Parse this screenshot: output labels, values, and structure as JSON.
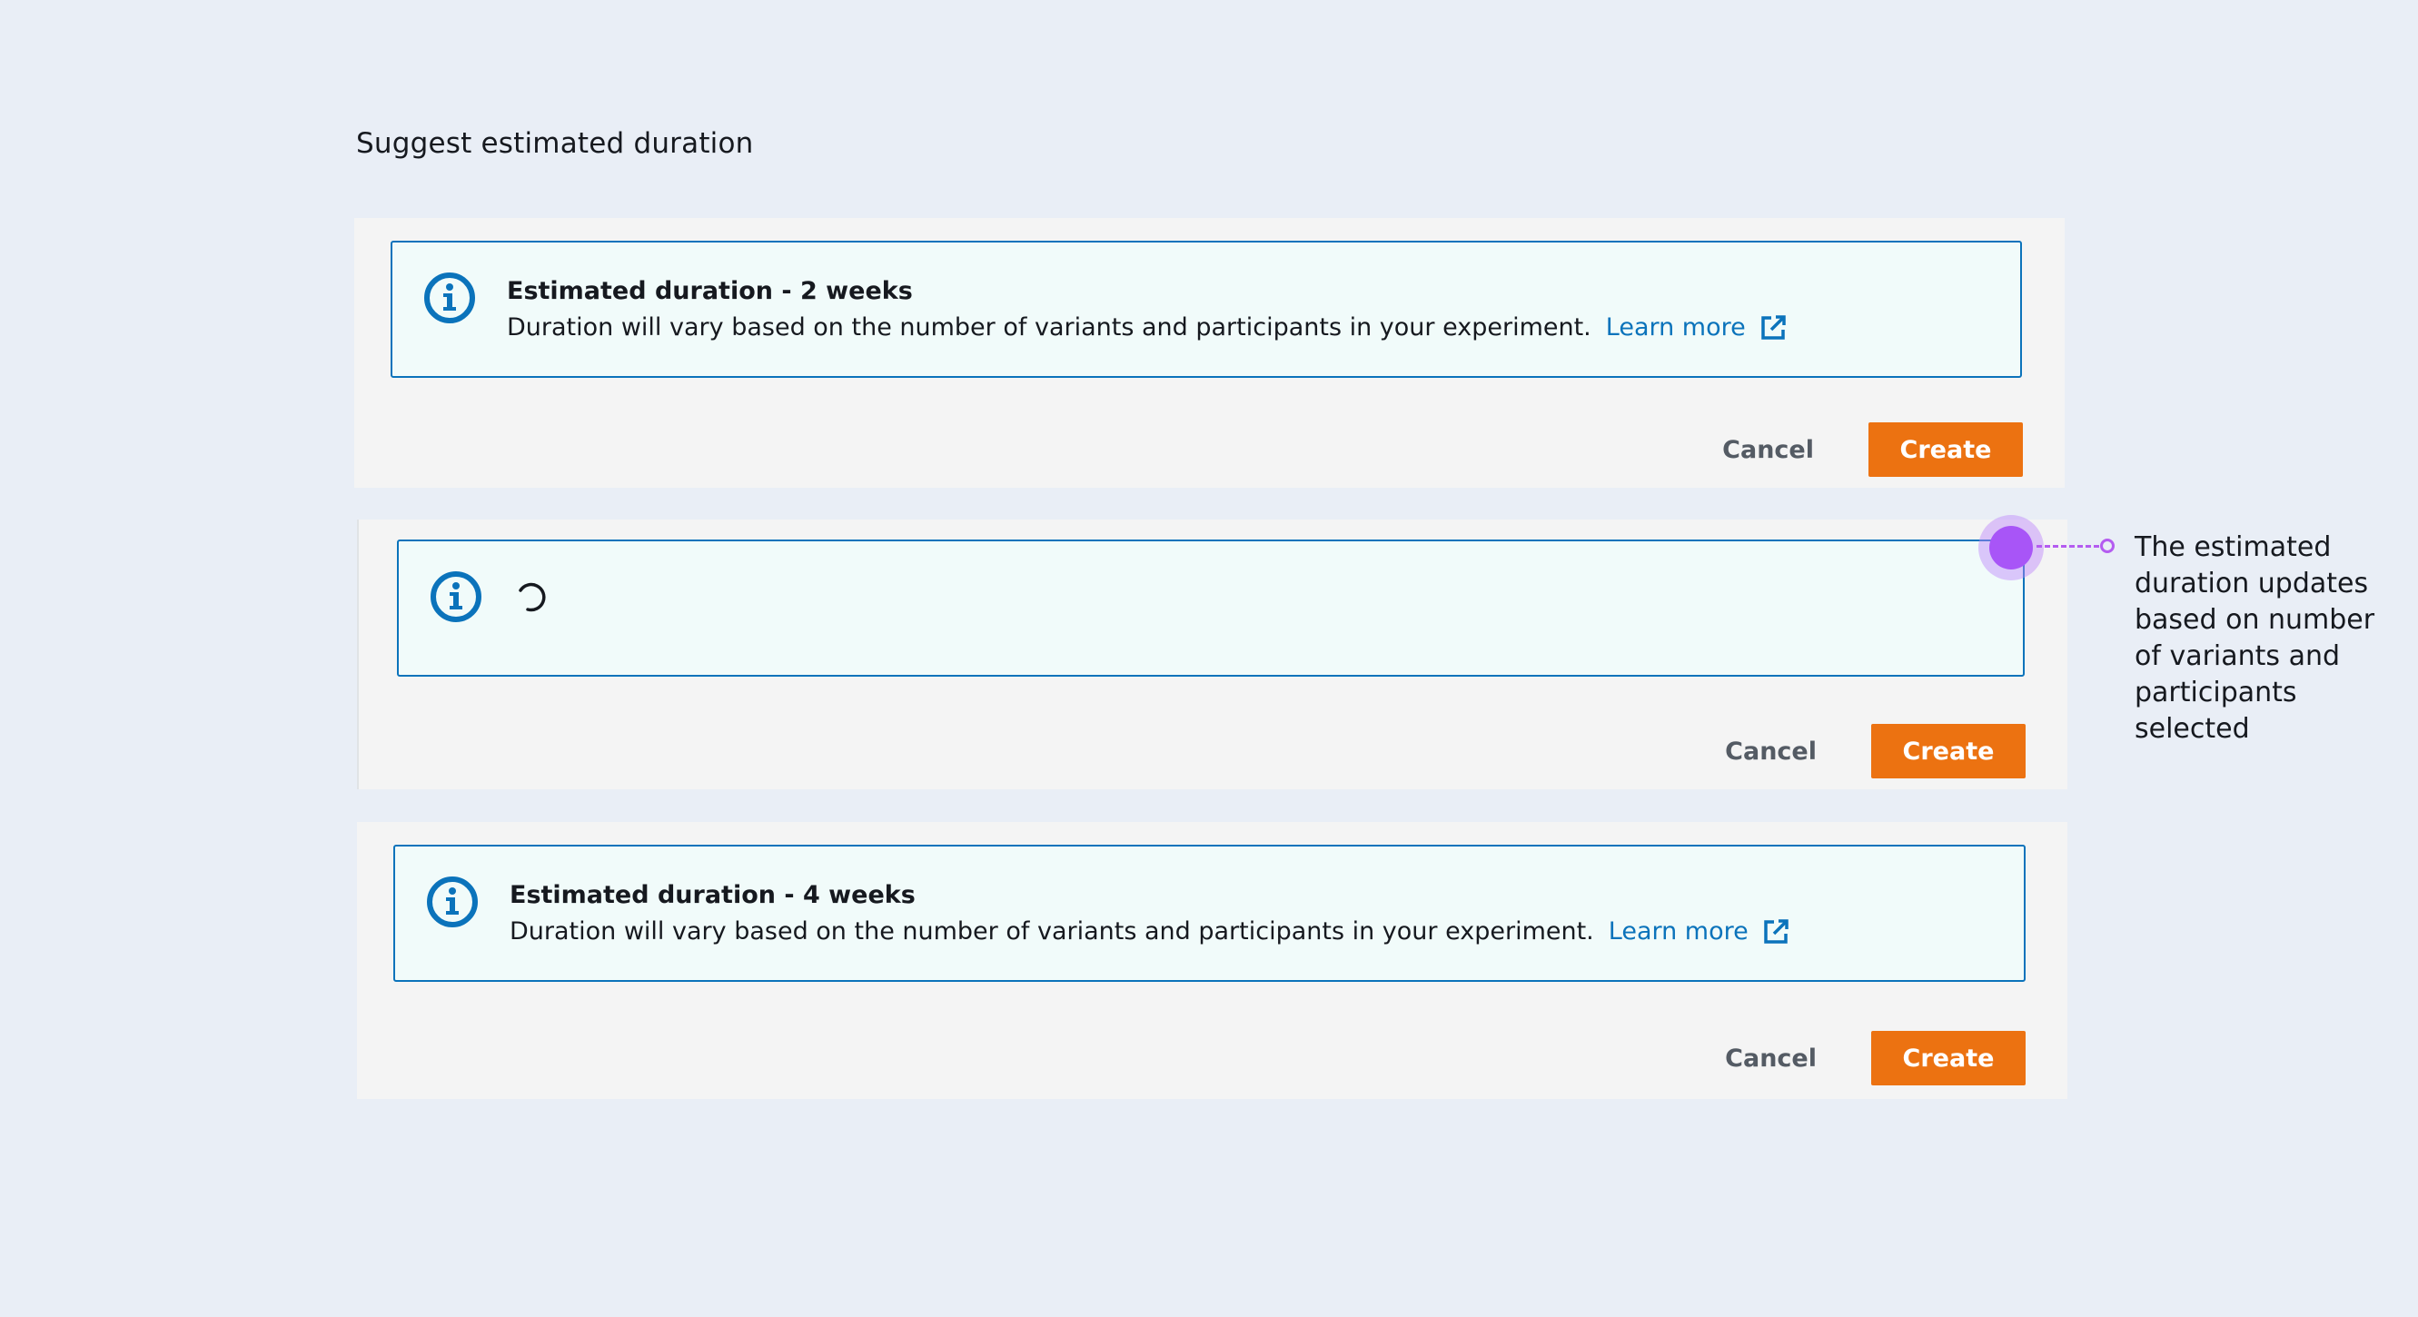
{
  "page": {
    "title": "Suggest estimated duration"
  },
  "colors": {
    "background": "#e9eef6",
    "card": "#f4f4f4",
    "alert_bg": "#f1fbfa",
    "info_blue": "#0b73bb",
    "primary": "#ec7211",
    "annotation": "#a855f7"
  },
  "cards": [
    {
      "state": "loaded",
      "alert": {
        "icon": "info-icon",
        "title": "Estimated duration - 2 weeks",
        "description": "Duration will vary based on the number of variants and participants in your experiment.",
        "link_label": "Learn more",
        "link_icon": "external-link-icon"
      },
      "cancel_label": "Cancel",
      "create_label": "Create"
    },
    {
      "state": "loading",
      "alert": {
        "icon": "info-icon",
        "loading_icon": "spinner-icon"
      },
      "cancel_label": "Cancel",
      "create_label": "Create"
    },
    {
      "state": "loaded",
      "alert": {
        "icon": "info-icon",
        "title": "Estimated duration - 4 weeks",
        "description": "Duration will vary based on the number of variants and participants in your experiment.",
        "link_label": "Learn more",
        "link_icon": "external-link-icon"
      },
      "cancel_label": "Cancel",
      "create_label": "Create"
    }
  ],
  "annotation": {
    "text": "The estimated duration updates based on number of variants and participants selected"
  }
}
